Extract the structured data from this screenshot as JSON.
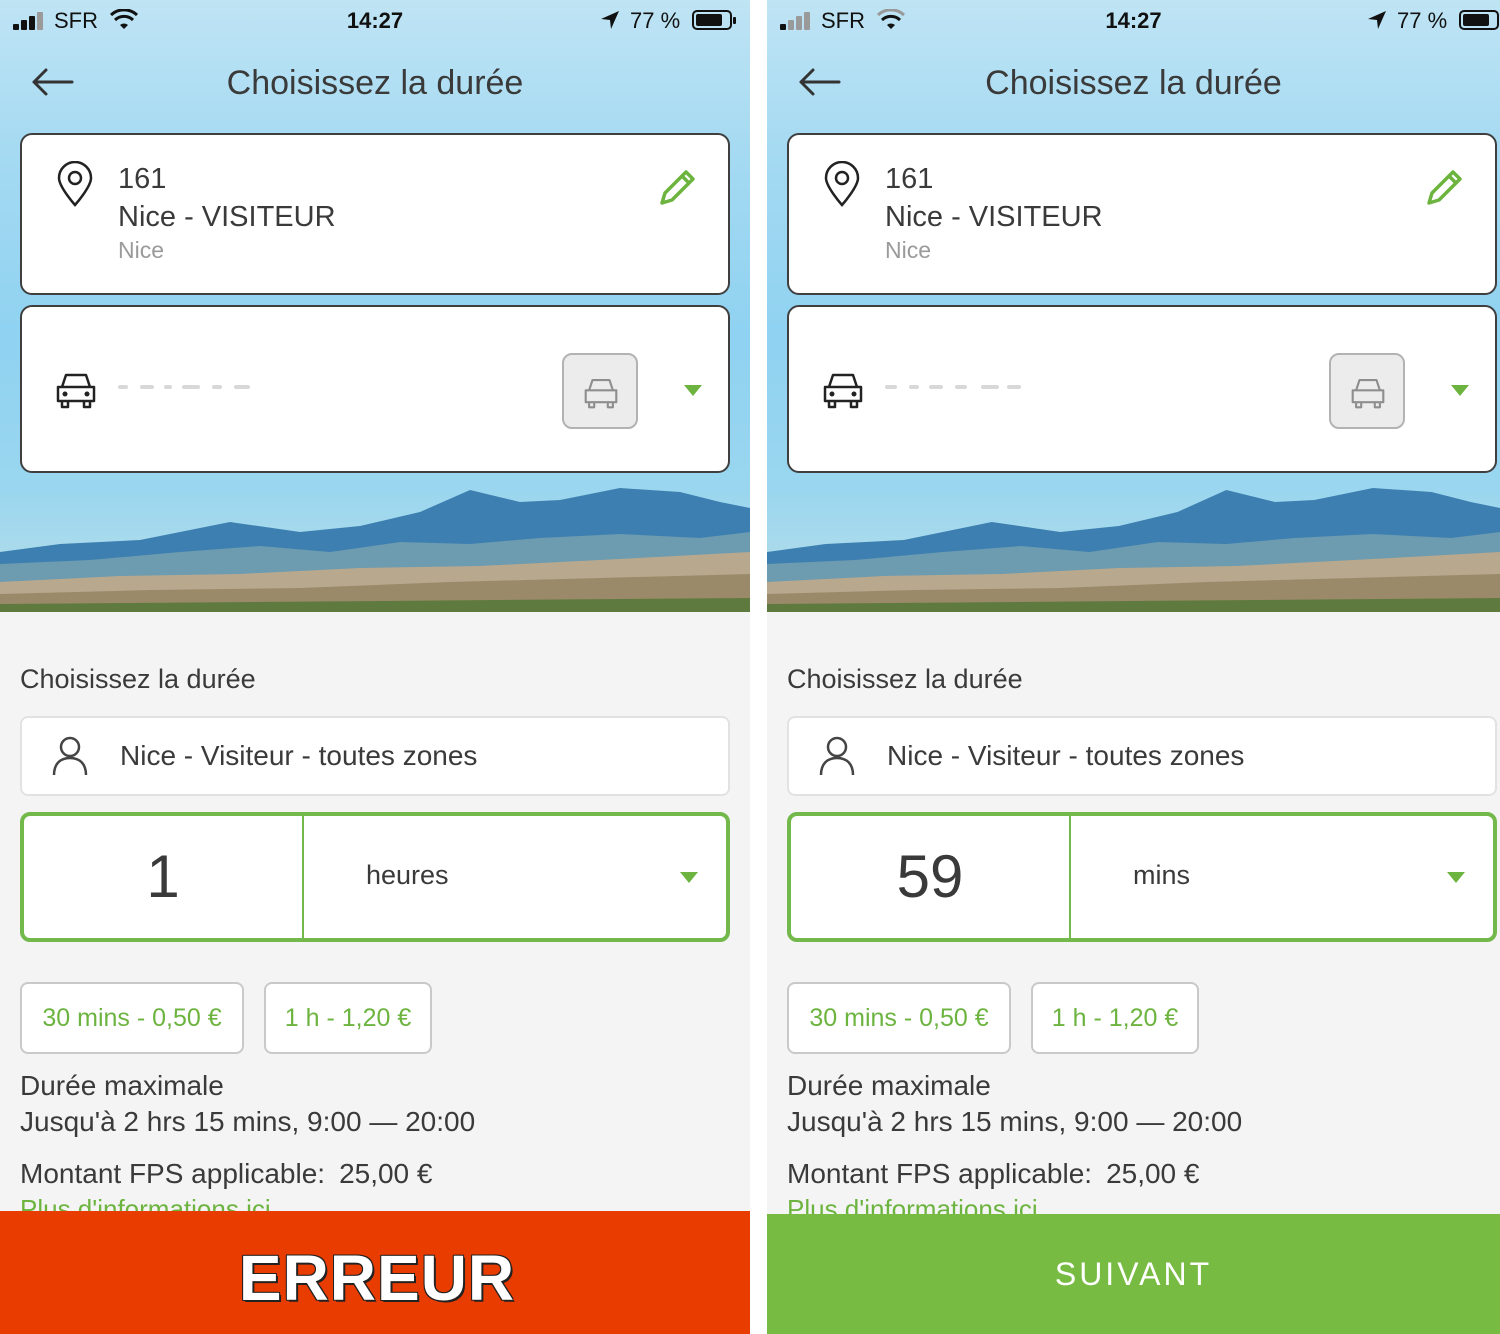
{
  "colors": {
    "accent_green": "#73b84a",
    "error_red": "#e83c00",
    "next_green": "#77bb43"
  },
  "screens": [
    {
      "status": {
        "carrier": "SFR",
        "time": "14:27",
        "battery": "77 %"
      },
      "nav": {
        "title": "Choisissez la durée",
        "back_icon": "arrow-left-icon"
      },
      "location": {
        "id": "161",
        "name": "Nice - VISITEUR",
        "city": "Nice"
      },
      "section_title": "Choisissez la durée",
      "zone": {
        "label": "Nice - Visiteur - toutes zones"
      },
      "duration": {
        "value": "1",
        "unit": "heures"
      },
      "chips": [
        "30 mins - 0,50 €",
        "1 h - 1,20 €"
      ],
      "max_label": "Durée maximale",
      "max_value": "Jusqu'à 2 hrs 15 mins, 9:00 — 20:00",
      "fps_label": "Montant FPS applicable:",
      "fps_amount": "25,00 €",
      "more_link": "Plus d'informations ici",
      "bottom_button": "ERREUR"
    },
    {
      "status": {
        "carrier": "SFR",
        "time": "14:27",
        "battery": "77 %"
      },
      "nav": {
        "title": "Choisissez la durée",
        "back_icon": "arrow-left-icon"
      },
      "location": {
        "id": "161",
        "name": "Nice - VISITEUR",
        "city": "Nice"
      },
      "section_title": "Choisissez la durée",
      "zone": {
        "label": "Nice - Visiteur - toutes zones"
      },
      "duration": {
        "value": "59",
        "unit": "mins"
      },
      "chips": [
        "30 mins - 0,50 €",
        "1 h - 1,20 €"
      ],
      "max_label": "Durée maximale",
      "max_value": "Jusqu'à 2 hrs 15 mins, 9:00 — 20:00",
      "fps_label": "Montant FPS applicable:",
      "fps_amount": "25,00 €",
      "more_link": "Plus d'informations ici",
      "bottom_button": "SUIVANT"
    }
  ]
}
